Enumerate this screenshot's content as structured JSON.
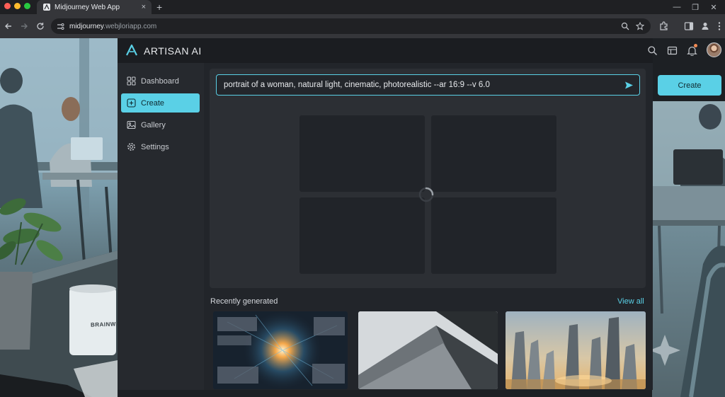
{
  "browser": {
    "tab_title": "Midjourney Web App",
    "tab_close": "×",
    "new_tab": "+",
    "url_host": "midjourney",
    "url_rest": ".webjloriapp.com",
    "window_controls": [
      "—",
      "❐",
      "✕"
    ]
  },
  "app": {
    "brand": "ARTISAN AI",
    "header_icons": [
      "search-icon",
      "cards-icon",
      "bell-icon",
      "avatar"
    ],
    "sidebar": {
      "items": [
        {
          "label": "Dashboard",
          "icon": "grid-icon",
          "active": false
        },
        {
          "label": "Create",
          "icon": "plus-square-icon",
          "active": true
        },
        {
          "label": "Gallery",
          "icon": "image-icon",
          "active": false
        },
        {
          "label": "Settings",
          "icon": "gear-icon",
          "active": false
        }
      ]
    },
    "prompt": {
      "value": "portrait of a woman, natural light, cinematic, photorealistic --ar 16:9 --v 6.0"
    },
    "create_button": "Create",
    "recent": {
      "title": "Recently generated",
      "view_all": "View all",
      "thumbnails": [
        "cosmic-network-thumbnail",
        "abstract-architecture-thumbnail",
        "futuristic-city-thumbnail"
      ]
    },
    "colors": {
      "accent": "#5ad0e6",
      "app_bg": "#22252a",
      "sidebar_bg": "#26292e",
      "header_bg": "#1b1d21"
    }
  },
  "scene": {
    "mug_text": "BRAINWA"
  }
}
